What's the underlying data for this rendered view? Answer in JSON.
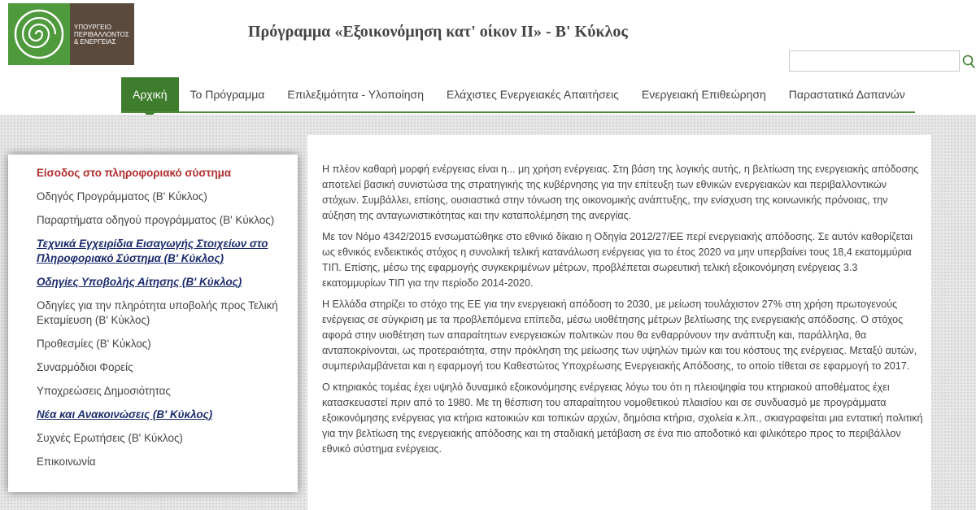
{
  "header": {
    "logo_text_lines": [
      "ΥΠΟΥΡΓΕΙΟ",
      "ΠΕΡΙΒΑΛΛΟΝΤΟΣ",
      "& ΕΝΕΡΓΕΙΑΣ"
    ],
    "site_title": "Πρόγραμμα «Εξοικονόμηση κατ' οίκον ΙΙ» - Β' Κύκλος",
    "search_value": "",
    "colors": {
      "logo_green": "#4e9a3c",
      "logo_brown": "#5b4a3c",
      "accent_green": "#3f7d2e"
    },
    "search_icon": "search-icon"
  },
  "nav": {
    "items": [
      {
        "label": "Αρχική"
      },
      {
        "label": "Το Πρόγραμμα"
      },
      {
        "label": "Επιλεξιμότητα - Υλοποίηση"
      },
      {
        "label": "Ελάχιστες Ενεργειακές Απαιτήσεις"
      },
      {
        "label": "Ενεργειακή Επιθεώρηση"
      },
      {
        "label": "Παραστατικά Δαπανών"
      }
    ]
  },
  "sidebar": {
    "items": [
      {
        "label": "Είσοδος στο πληροφοριακό σύστημα"
      },
      {
        "label": "Οδηγός Προγράμματος (Β' Κύκλος)"
      },
      {
        "label": "Παραρτήματα οδηγού προγράμματος (Β' Κύκλος)"
      },
      {
        "label": "Τεχνικά Εγχειρίδια Εισαγωγής Στοιχείων στο Πληροφοριακό Σύστημα (Β' Κύκλος)"
      },
      {
        "label": "Οδηγίες Υποβολής Αίτησης (Β' Κύκλος)"
      },
      {
        "label": "Οδηγίες για την πληρότητα υποβολής προς Τελική Εκταμίευση (Β' Κύκλος)"
      },
      {
        "label": "Προθεσμίες (Β' Κύκλος)"
      },
      {
        "label": "Συναρμόδιοι Φορείς"
      },
      {
        "label": "Υποχρεώσεις Δημοσιότητας"
      },
      {
        "label": "Νέα και Ανακοινώσεις (Β' Κύκλος)"
      },
      {
        "label": "Συχνές Ερωτήσεις (Β' Κύκλος)"
      },
      {
        "label": "Επικοινωνία"
      }
    ]
  },
  "main": {
    "paragraphs": [
      "Η πλέον καθαρή μορφή ενέργειας είναι η... μη χρήση ενέργειας. Στη βάση της λογικής αυτής, η βελτίωση της ενεργειακής απόδοσης αποτελεί βασική συνιστώσα της στρατηγικής της κυβέρνησης για την επίτευξη των εθνικών ενεργειακών και περιβαλλοντικών στόχων. Συμβάλλει, επίσης, ουσιαστικά στην τόνωση της οικονομικής ανάπτυξης, την ενίσχυση της κοινωνικής πρόνοιας, την αύξηση της ανταγωνιστικότητας και την καταπολέμηση της ανεργίας.",
      "Με τον Νόμο 4342/2015 ενσωματώθηκε στο εθνικό δίκαιο η Οδηγία 2012/27/ΕΕ περί ενεργειακής απόδοσης. Σε αυτόν καθορίζεται ως εθνικός ενδεικτικός στόχος η συνολική τελική κατανάλωση ενέργειας για το έτος 2020 να μην υπερβαίνει τους 18,4 εκατομμύρια ΤΙΠ. Επίσης, μέσω της εφαρμογής συγκεκριμένων μέτρων, προβλέπεται σωρευτική τελική εξοικονόμηση ενέργειας 3.3 εκατομμυρίων ΤΙΠ για την περίοδο 2014-2020.",
      "Η Ελλάδα στηρίζει το στόχο της ΕΕ για την ενεργειακή απόδοση το 2030, με μείωση τουλάχιστον 27% στη χρήση πρωτογενούς ενέργειας σε σύγκριση με τα προβλεπόμενα επίπεδα, μέσω υιοθέτησης μέτρων βελτίωσης της ενεργειακής απόδοσης. Ο στόχος αφορά στην υιοθέτηση των απαραίτητων ενεργειακών πολιτικών που θα ενθαρρύνουν την ανάπτυξη και, παράλληλα, θα ανταποκρίνονται, ως προτεραιότητα, στην πρόκληση της μείωσης των υψηλών τιμών και του κόστους της ενέργειας. Μεταξύ αυτών, συμπεριλαμβάνεται και η εφαρμογή του Καθεστώτος Υποχρέωσης Ενεργειακής Απόδοσης, το οποίο τίθεται σε εφαρμογή το 2017.",
      "Ο κτηριακός τομέας έχει υψηλό δυναμικό εξοικονόμησης ενέργειας λόγω του ότι η πλειοψηφία του κτηριακού αποθέματος έχει κατασκευαστεί πριν από το 1980. Με τη θέσπιση του απαραίτητου νομοθετικού πλαισίου και σε συνδυασμό με προγράμματα εξοικονόμησης ενέργειας για κτήρια κατοικιών και τοπικών αρχών, δημόσια κτήρια, σχολεία κ.λπ., σκιαγραφείται μια εντατική πολιτική για την βελτίωση της ενεργειακής απόδοσης και τη σταδιακή μετάβαση σε ένα πιο αποδοτικό και φιλικότερο προς το περιβάλλον εθνικό σύστημα ενέργειας."
    ]
  }
}
